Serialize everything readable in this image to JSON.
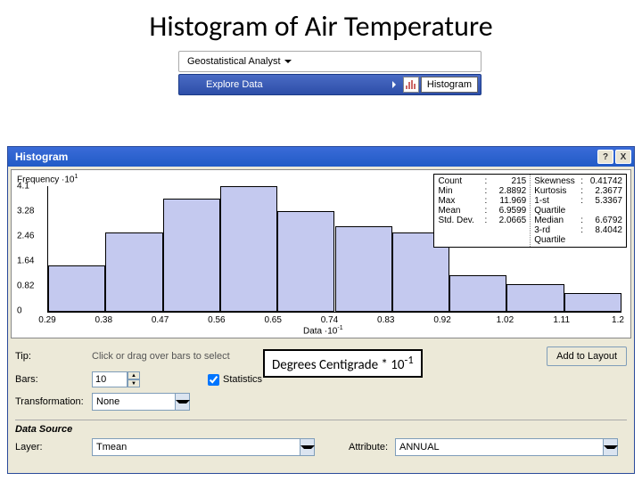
{
  "title": "Histogram of Air Temperature",
  "toolbar": {
    "analyst_label": "Geostatistical Analyst",
    "explore_label": "Explore Data",
    "histogram_label": "Histogram"
  },
  "window": {
    "title": "Histogram",
    "help_label": "?",
    "close_label": "X"
  },
  "stats": {
    "left": [
      {
        "label": "Count",
        "value": "215"
      },
      {
        "label": "Min",
        "value": "2.8892"
      },
      {
        "label": "Max",
        "value": "11.969"
      },
      {
        "label": "Mean",
        "value": "6.9599"
      },
      {
        "label": "Std. Dev.",
        "value": "2.0665"
      }
    ],
    "right": [
      {
        "label": "Skewness",
        "value": "0.41742"
      },
      {
        "label": "Kurtosis",
        "value": "2.3677"
      },
      {
        "label": "1-st Quartile",
        "value": "5.3367"
      },
      {
        "label": "Median",
        "value": "6.6792"
      },
      {
        "label": "3-rd Quartile",
        "value": "8.4042"
      }
    ]
  },
  "chart_data": {
    "type": "bar",
    "ylabel": "Frequency ·10",
    "ysup": "1",
    "xlabel": "Data ·10",
    "xsup": "-1",
    "ylim": [
      0,
      4.1
    ],
    "yticks": [
      0,
      0.82,
      1.64,
      2.46,
      3.28,
      4.1
    ],
    "xticks": [
      0.29,
      0.38,
      0.47,
      0.56,
      0.65,
      0.74,
      0.83,
      0.92,
      1.02,
      1.11,
      1.2
    ],
    "values": [
      1.5,
      2.6,
      3.7,
      4.1,
      3.3,
      2.8,
      2.6,
      1.2,
      0.9,
      0.6
    ]
  },
  "controls": {
    "tip_label": "Tip:",
    "tip_text": "Click or drag over bars to select",
    "bars_label": "Bars:",
    "bars_value": "10",
    "statistics_label": "Statistics",
    "transformation_label": "Transformation:",
    "transformation_value": "None",
    "add_layout_label": "Add to Layout",
    "data_source_heading": "Data Source",
    "layer_label": "Layer:",
    "layer_value": "Tmean",
    "attribute_label": "Attribute:",
    "attribute_value": "ANNUAL"
  },
  "annotation": {
    "text_prefix": "Degrees Centigrade * 10",
    "text_sup": "-1"
  }
}
